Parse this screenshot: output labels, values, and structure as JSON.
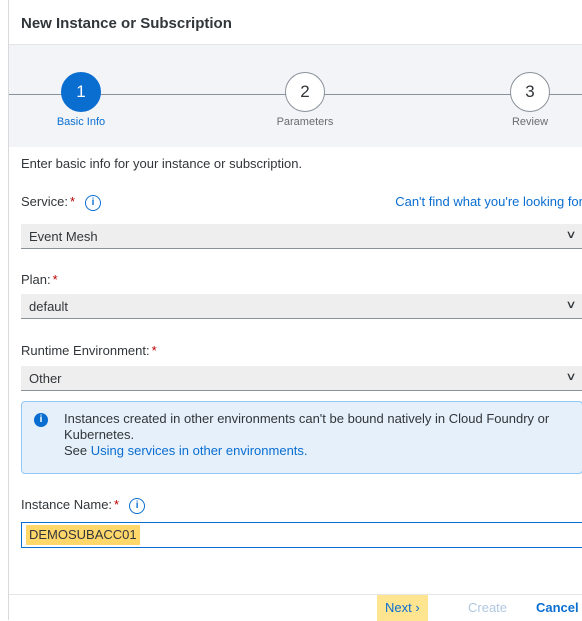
{
  "dialog": {
    "title": "New Instance or Subscription"
  },
  "wizard": {
    "steps": [
      {
        "number": "1",
        "label": "Basic Info"
      },
      {
        "number": "2",
        "label": "Parameters"
      },
      {
        "number": "3",
        "label": "Review"
      }
    ],
    "active_step": 1
  },
  "form": {
    "intro": "Enter basic info for your instance or subscription.",
    "service": {
      "label": "Service:",
      "value": "Event Mesh",
      "link": "Can't find what you're looking for"
    },
    "plan": {
      "label": "Plan:",
      "value": "default"
    },
    "runtime": {
      "label": "Runtime Environment:",
      "value": "Other"
    },
    "message": {
      "text": "Instances created in other environments can't be bound natively in Cloud Foundry or Kubernetes.",
      "see": "See",
      "link": "Using services in other environments."
    },
    "instance_name": {
      "label": "Instance Name:",
      "value": "DEMOSUBACC01"
    },
    "required_marker": "*",
    "info_icon_glyph": "i"
  },
  "footer": {
    "next": "Next",
    "next_glyph": "›",
    "create": "Create",
    "cancel": "Cancel"
  },
  "colors": {
    "accent": "#0a6ed1",
    "required": "#bb0000",
    "highlight": "#ffd76a",
    "info_bg": "#e5f0fa"
  },
  "icons": {
    "chevron": "chevron-down-icon",
    "info": "info-icon"
  }
}
